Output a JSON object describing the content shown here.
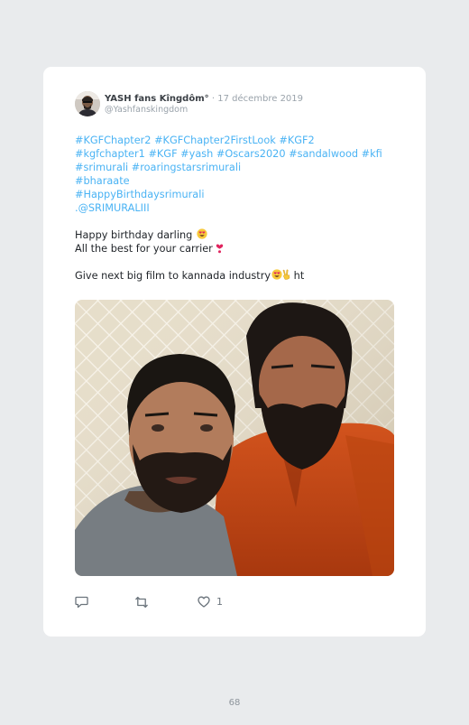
{
  "tweet": {
    "author_name": "YASH fans Kîngdôm°",
    "separator": "·",
    "date": "17 décembre 2019",
    "handle": "@Yashfanskingdom",
    "hashtag_rows": [
      [
        "#KGFChapter2",
        "#KGFChapter2FirstLook",
        "#KGF2"
      ],
      [
        "#kgfchapter1",
        "#KGF",
        "#yash",
        "#Oscars2020",
        "#sandalwood",
        "#kfi"
      ],
      [
        "#srimurali",
        "#roaringstarsrimurali"
      ],
      [
        "#bharaate"
      ],
      [
        "#HappyBirthdaysrimurali"
      ],
      [
        ".@SRIMURALIII"
      ]
    ],
    "message_line1": "Happy birthday darling",
    "message_line2": "All the best for your carrier",
    "message_line3": "Give next big film to kannada industry",
    "message_line3_tail": " ht",
    "likes": "1",
    "link_color": "#4ab3f4"
  },
  "icons": [
    "reply-icon",
    "retweet-icon",
    "like-icon",
    "heart-eyes-emoji",
    "red-heart-emoji",
    "victory-hand-emoji"
  ],
  "page": {
    "number": "68"
  }
}
